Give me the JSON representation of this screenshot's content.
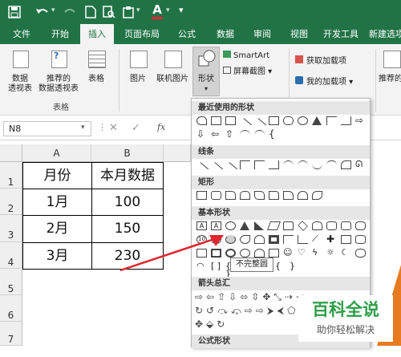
{
  "colors": {
    "excel_green": "#217346",
    "orange_accent": "#e87a1f",
    "arrow_red": "#e0252e"
  },
  "quick_access": {
    "icons": [
      "save-icon",
      "undo-icon",
      "redo-icon",
      "new-icon",
      "print-preview-icon",
      "paste-icon",
      "font-color-icon",
      "dropdown-icon"
    ],
    "font_color_letter": "A"
  },
  "ribbon_tabs": [
    "文件",
    "开始",
    "插入",
    "页面布局",
    "公式",
    "数据",
    "审阅",
    "视图",
    "开发工具",
    "新建选项"
  ],
  "ribbon": {
    "pivot_table": "数据\n透视表",
    "recommended_pivot": "推荐的\n数据透视表",
    "table": "表格",
    "group_tables": "表格",
    "picture": "图片",
    "online_picture": "联机图片",
    "shapes": "形状",
    "smartart": "SmartArt",
    "screenshot": "屏幕截图",
    "get_addins": "获取加载项",
    "my_addins": "我的加载项",
    "recommended_charts": "推荐的图"
  },
  "formula_bar": {
    "name_box": "N8",
    "fx": "fx"
  },
  "sheet": {
    "col_headers": [
      "A",
      "B"
    ],
    "row_headers": [
      "1",
      "2",
      "3",
      "4",
      "5",
      "6",
      "7"
    ],
    "table": {
      "header": [
        "月份",
        "本月数据"
      ],
      "rows": [
        [
          "1月",
          "100"
        ],
        [
          "2月",
          "150"
        ],
        [
          "3月",
          "230"
        ]
      ]
    }
  },
  "shapes_panel": {
    "sections": [
      "最近使用的形状",
      "线条",
      "矩形",
      "基本形状",
      "箭头总汇",
      "公式形状"
    ],
    "tooltip": "不完整圆"
  },
  "watermark": {
    "title": "百科全说",
    "subtitle": "助你轻松解决"
  }
}
